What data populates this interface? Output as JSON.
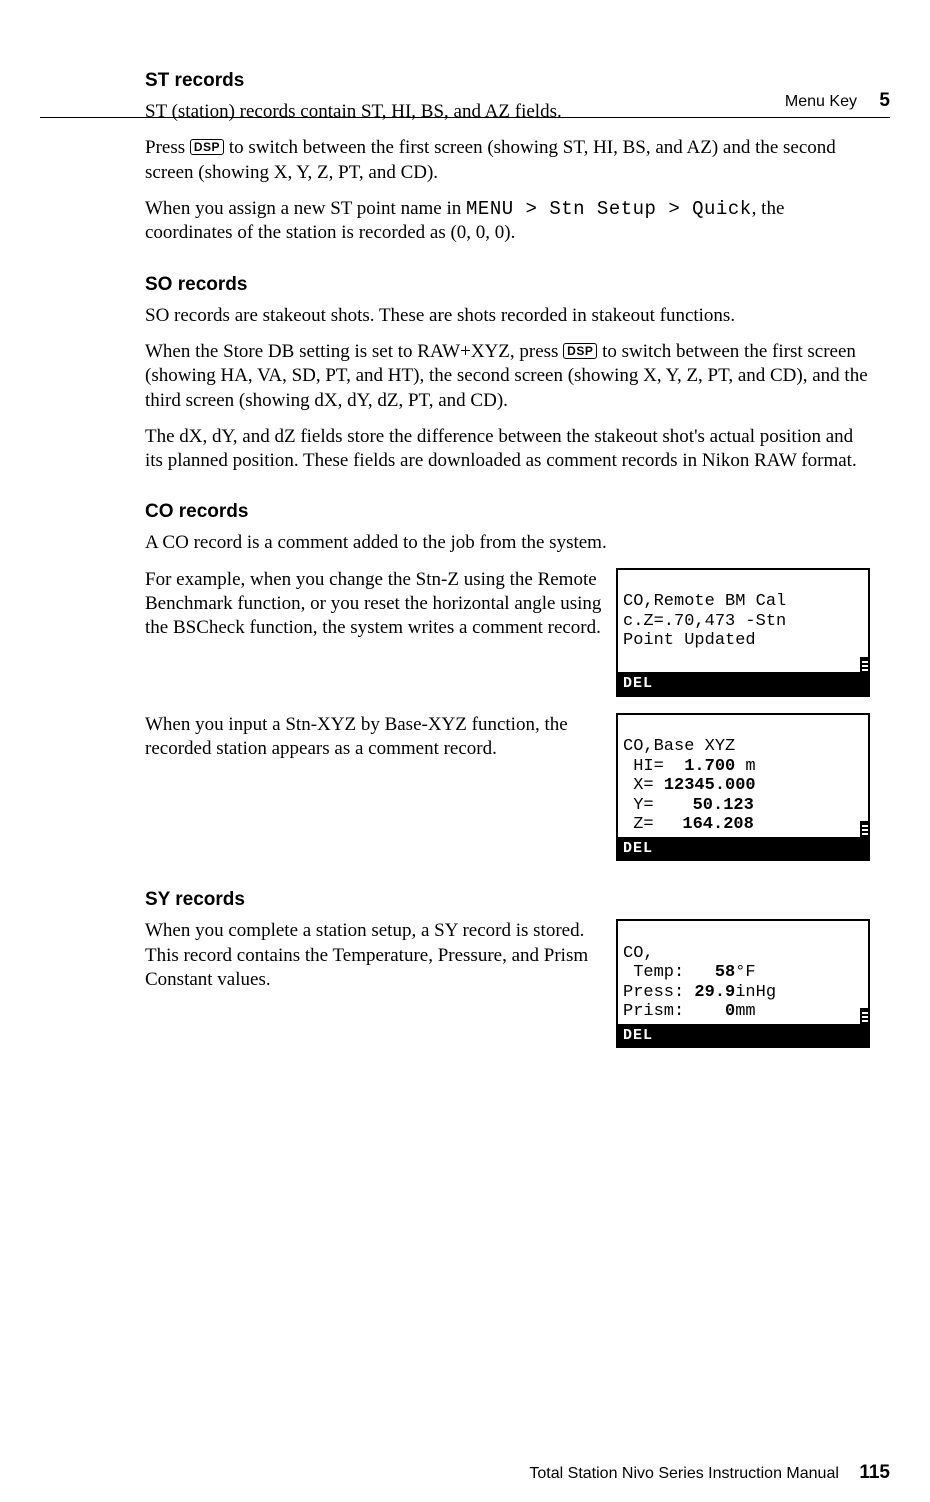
{
  "header": {
    "section": "Menu Key",
    "chapter": "5"
  },
  "dsp_label": "DSP",
  "st": {
    "heading": "ST records",
    "p1": "ST (station) records contain ST, HI, BS, and AZ fields.",
    "p2a": "Press ",
    "p2b": " to switch between the first screen (showing ST, HI, BS, and AZ) and the second screen (showing X, Y, Z, PT, and CD).",
    "p3a": "When you assign a new ST point name in ",
    "p3_menu": "MENU > Stn Setup > Quick",
    "p3b": ", the coordinates of the station is recorded as (0, 0, 0)."
  },
  "so": {
    "heading": "SO records",
    "p1": "SO records are stakeout shots. These are shots recorded in stakeout functions.",
    "p2a": "When the Store DB setting is set to RAW+XYZ, press ",
    "p2b": " to switch between the first screen (showing HA, VA, SD, PT, and HT), the second screen (showing X, Y, Z, PT, and CD), and the third screen (showing dX, dY, dZ, PT, and CD).",
    "p3": "The dX, dY, and dZ fields store the difference between the stakeout shot's actual position and its planned position. These fields are downloaded as comment records in Nikon RAW format."
  },
  "co": {
    "heading": "CO records",
    "p1": "A CO record is a comment added to the job from the system.",
    "p2": "For example, when you change the Stn-Z using the Remote Benchmark function, or you reset the horizontal angle using the BSCheck function, the system writes a comment record.",
    "p3": "When you input a Stn-XYZ by Base-XYZ function, the recorded station appears as a comment record."
  },
  "sy": {
    "heading": "SY records",
    "p1": "When you complete a station setup, a SY record is stored. This record contains the Temperature, Pressure, and Prism Constant values."
  },
  "lcd1": {
    "l1": "CO,Remote BM Cal",
    "l2": "c.Z=.70,473 -Stn",
    "l3": "Point Updated",
    "del": "DEL"
  },
  "lcd2": {
    "l1": "CO,Base XYZ",
    "hi_label": " HI=",
    "hi_val": "1.700",
    "hi_unit": " m",
    "x_label": " X=",
    "x_val": "12345.000",
    "y_label": " Y=",
    "y_val": "50.123",
    "z_label": " Z=",
    "z_val": "164.208",
    "del": "DEL"
  },
  "lcd3": {
    "l1": "CO,",
    "t_label": " Temp:",
    "t_val": "58",
    "t_unit": "°F",
    "p_label": "Press:",
    "p_val": "29.9",
    "p_unit": "inHg",
    "r_label": "Prism:",
    "r_val": "0",
    "r_unit": "mm",
    "del": "DEL"
  },
  "footer": {
    "title": "Total Station Nivo Series Instruction Manual",
    "page": "115"
  }
}
